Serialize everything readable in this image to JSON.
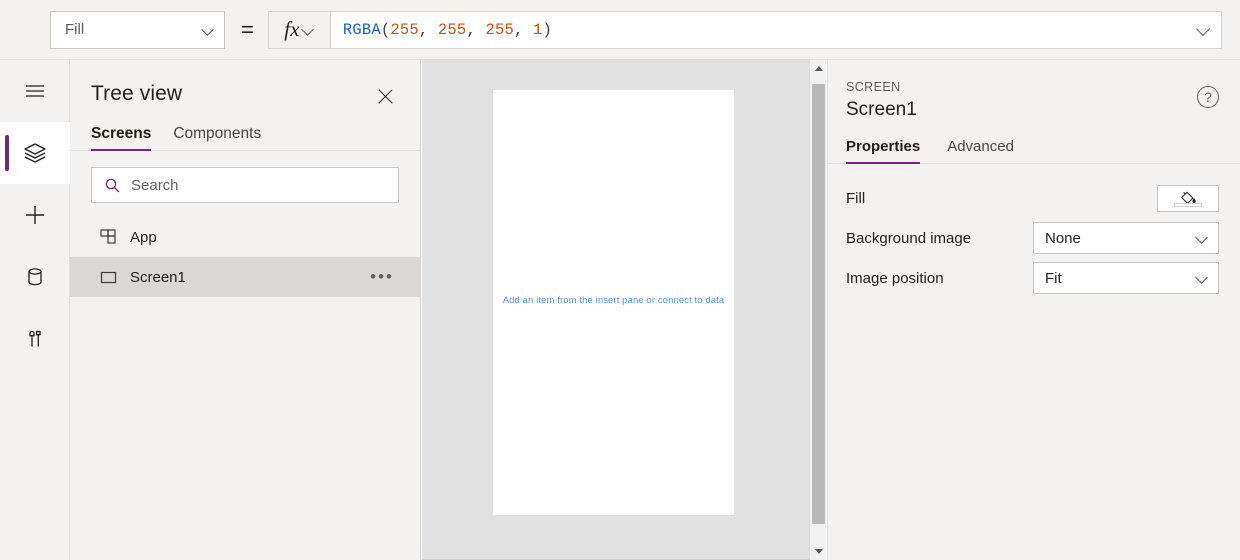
{
  "formula_bar": {
    "property_selector": {
      "value": "Fill",
      "icon": "chevron-down-icon"
    },
    "equals": "=",
    "fx_label": "fx",
    "formula": {
      "function_name": "RGBA",
      "open_paren": "(",
      "args": [
        "255",
        "255",
        "255",
        "1"
      ],
      "separator": ", ",
      "close_paren": ")",
      "full_text": "RGBA(255, 255, 255, 1)"
    },
    "expand_icon": "chevron-down-icon",
    "colors": {
      "function": "#1f5bbf",
      "number": "#c4500f",
      "punctuation": "#3b3a39"
    }
  },
  "rail": {
    "items": [
      {
        "name": "hamburger-menu",
        "icon": "hamburger-icon",
        "active": false
      },
      {
        "name": "tree-view",
        "icon": "layers-icon",
        "active": true
      },
      {
        "name": "insert",
        "icon": "plus-icon",
        "active": false
      },
      {
        "name": "data",
        "icon": "database-icon",
        "active": false
      },
      {
        "name": "settings-tools",
        "icon": "tools-icon",
        "active": false
      }
    ]
  },
  "treeview": {
    "title": "Tree view",
    "close_icon": "close-icon",
    "tabs": [
      {
        "label": "Screens",
        "selected": true
      },
      {
        "label": "Components",
        "selected": false
      }
    ],
    "search": {
      "placeholder": "Search",
      "value": "",
      "icon": "search-icon"
    },
    "items": [
      {
        "label": "App",
        "icon": "app-grid-icon",
        "selected": false,
        "has_more": false
      },
      {
        "label": "Screen1",
        "icon": "screen-rect-icon",
        "selected": true,
        "has_more": true,
        "more_label": "•••"
      }
    ]
  },
  "canvas": {
    "hint_text": "Add an item from the insert pane or connect to data",
    "hint_color": "#5b8fd6",
    "screen_fill": "#ffffff",
    "backdrop_color": "#e1e1e1",
    "scrollbar": {
      "up_icon": "triangle-up-icon",
      "down_icon": "triangle-down-icon"
    }
  },
  "properties": {
    "kind": "SCREEN",
    "name": "Screen1",
    "help_icon": "question-circle-icon",
    "tabs": [
      {
        "label": "Properties",
        "selected": true
      },
      {
        "label": "Advanced",
        "selected": false
      }
    ],
    "rows": [
      {
        "label": "Fill",
        "control": "color-swatch",
        "swatch_color": "#ffffff",
        "icon": "paint-bucket-icon"
      },
      {
        "label": "Background image",
        "control": "dropdown",
        "value": "None"
      },
      {
        "label": "Image position",
        "control": "dropdown",
        "value": "Fit"
      }
    ]
  },
  "theme": {
    "accent": "#742774",
    "panel_bg": "#f3f2f1",
    "selected_row": "#d9d8d7",
    "border": "#e1dfdd"
  }
}
